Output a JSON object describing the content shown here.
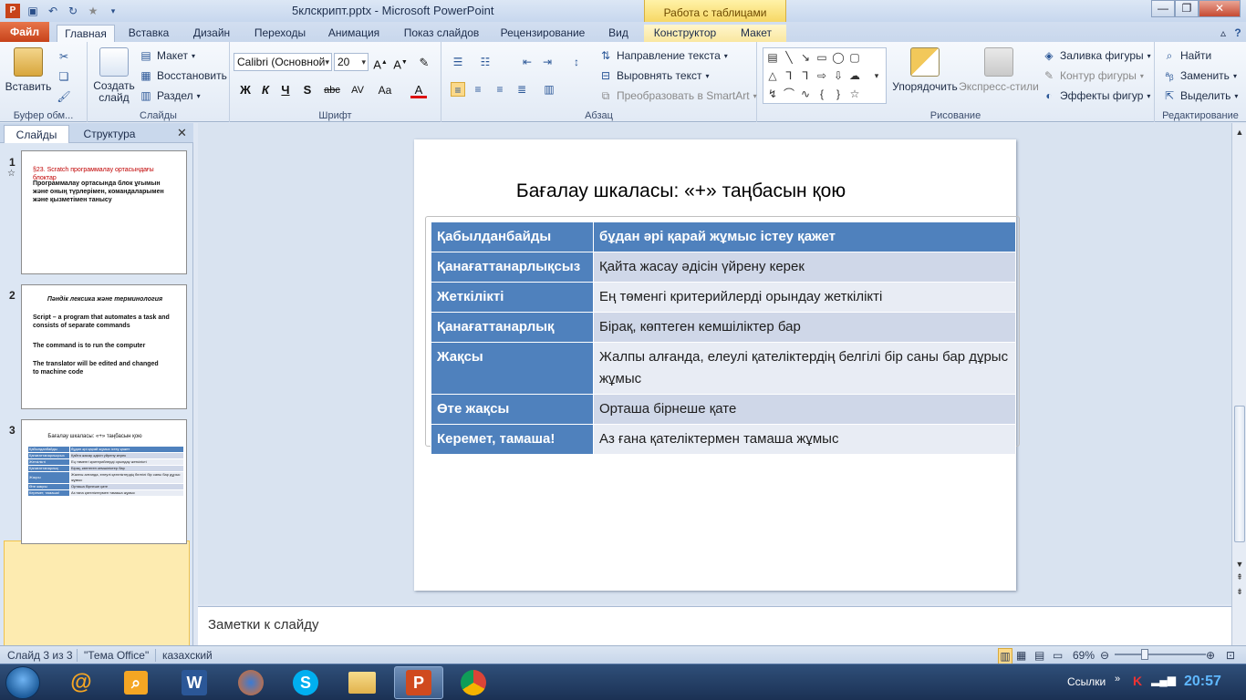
{
  "window": {
    "title": "5клскрипт.pptx  -  Microsoft PowerPoint",
    "context_tab_group": "Работа с таблицами"
  },
  "ribbon_tabs": {
    "file": "Файл",
    "home": "Главная",
    "insert": "Вставка",
    "design": "Дизайн",
    "transitions": "Переходы",
    "animation": "Анимация",
    "slideshow": "Показ слайдов",
    "review": "Рецензирование",
    "view": "Вид",
    "constructor": "Конструктор",
    "layout": "Макет"
  },
  "ribbon": {
    "clipboard": {
      "paste": "Вставить",
      "label": "Буфер обм..."
    },
    "slides": {
      "new_slide": "Создать слайд",
      "layout": "Макет",
      "reset": "Восстановить",
      "section": "Раздел",
      "label": "Слайды"
    },
    "font": {
      "font_name": "Calibri (Основной",
      "font_size": "20",
      "label": "Шрифт"
    },
    "paragraph": {
      "text_direction": "Направление текста",
      "align_text": "Выровнять текст",
      "smartart": "Преобразовать в SmartArt",
      "label": "Абзац"
    },
    "drawing": {
      "arrange": "Упорядочить",
      "quick_styles": "Экспресс-стили",
      "fill": "Заливка фигуры",
      "outline": "Контур фигуры",
      "effects": "Эффекты фигур",
      "label": "Рисование"
    },
    "editing": {
      "find": "Найти",
      "replace": "Заменить",
      "select": "Выделить",
      "label": "Редактирование"
    }
  },
  "left_panel": {
    "tab_slides": "Слайды",
    "tab_outline": "Структура",
    "thumbs": [
      {
        "num": "1",
        "title": "§23. Scratch программалау ортасындағы блоктар",
        "body": "Программалау ортасында блок ұғымын және оның түрлерімен, командаларымен  және қызметімен танысу"
      },
      {
        "num": "2",
        "title": "Пәндік лексика және терминология",
        "lines": [
          "Script –  a program that automates a task and consists of separate commands",
          "The command is to run the computer",
          "The translator will be edited and changed to machine code"
        ]
      },
      {
        "num": "3",
        "title": "Бағалау шкаласы: «+» таңбасын қою"
      }
    ]
  },
  "slide": {
    "title": "Бағалау шкаласы: «+» таңбасын қою",
    "rows": [
      {
        "k": "Қабылданбайды",
        "v": "бұдан әрі қарай жұмыс істеу қажет"
      },
      {
        "k": "Қанағаттанарлықсыз",
        "v": "Қайта жасау әдісін үйрену керек"
      },
      {
        "k": "Жеткілікті",
        "v": "Ең төменгі критерийлерді  орындау жеткілікті"
      },
      {
        "k": "Қанағаттанарлық",
        "v": "Бірақ, көптеген кемшіліктер  бар"
      },
      {
        "k": "Жақсы",
        "v": "Жалпы алғанда, елеулі  қателіктердің  белгілі бір саны бар дұрыс жұмыс"
      },
      {
        "k": "Өте жақсы",
        "v": "Орташа бірнеше қате"
      },
      {
        "k": "Керемет, тамаша!",
        "v": "Аз ғана қателіктермен тамаша жұмыс"
      }
    ]
  },
  "notes": {
    "placeholder": "Заметки к слайду"
  },
  "status": {
    "slide_info": "Слайд 3 из 3",
    "theme": "\"Тема Office\"",
    "language": "казахский",
    "zoom": "69%"
  },
  "taskbar": {
    "links": "Ссылки",
    "clock": "20:57"
  }
}
